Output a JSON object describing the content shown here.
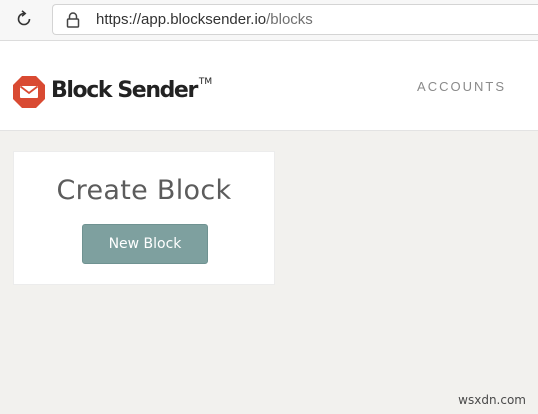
{
  "browser": {
    "url_host": "https://app.blocksender.io",
    "url_path": "/blocks",
    "reload_icon": "reload-icon",
    "lock_icon": "lock-icon"
  },
  "header": {
    "logo_text": "Block Sender",
    "logo_tm": "TM",
    "logo_icon": "envelope-stop-icon",
    "nav_accounts": "ACCOUNTS"
  },
  "card": {
    "title": "Create Block",
    "button_label": "New Block"
  },
  "watermark": "wsxdn.com",
  "colors": {
    "brand_red": "#d94a32",
    "button": "#7ea09f",
    "page_bg": "#f2f1ee"
  }
}
